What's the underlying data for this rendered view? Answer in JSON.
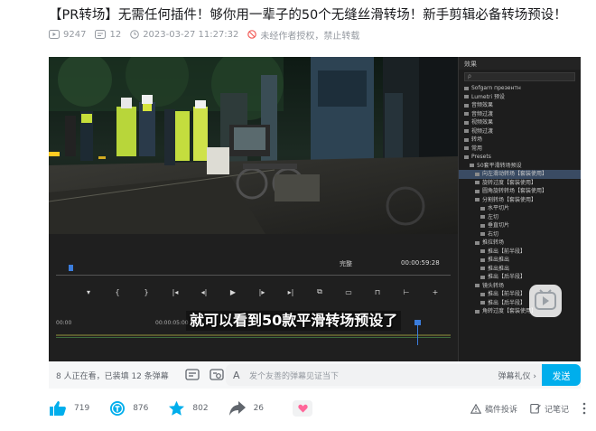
{
  "video": {
    "title": "【PR转场】无需任何插件！够你用一辈子的50个无缝丝滑转场！新手剪辑必备转场预设！",
    "plays": "9247",
    "danmaku_count": "12",
    "published": "2023-03-27 11:27:32",
    "copyright_note": "未经作者授权，禁止转载"
  },
  "player": {
    "subtitle": "就可以看到50款平滑转场预设了",
    "fit_label": "完整",
    "timecode": "00:00:59:28",
    "ruler_left": "00:00",
    "ruler_mid": "00:00:05:00",
    "panel": {
      "header": "效果",
      "search_placeholder": "ρ",
      "items": [
        "Sofgarn презентн",
        "Lumetri 预设",
        "音频效果",
        "音频过渡",
        "视频效果",
        "视频过渡",
        "转场",
        "常用",
        "Presets",
        "50套平滑转场预设",
        "向左滑动转场【套装使用】",
        "旋转过度【套装使用】",
        "圆角旋转转场【套装使用】",
        "分割转场【套装使用】",
        "水平切片",
        "左切",
        "垂直切片",
        "右切",
        "推拉转场",
        "推出【前半段】",
        "推出推出",
        "推出推出",
        "推出【后半段】",
        "镜头转场",
        "推出【前半段】",
        "推出【后半段】",
        "角转过度【套装使用】"
      ],
      "selected_index": 10
    }
  },
  "danmu_bar": {
    "viewers": "8 人正在看，已装填 12 条弹幕",
    "input_icon": "A",
    "placeholder": "发个友善的弹幕见证当下",
    "etiquette": "弹幕礼仪 ›",
    "send": "发送"
  },
  "actions": {
    "like": "719",
    "coin": "876",
    "fav": "802",
    "share": "26",
    "report": "稿件投诉",
    "notes": "记笔记"
  },
  "colors": {
    "accent": "#00aeec",
    "icon_blue": "#00aeec",
    "muted": "#9499a0",
    "heart": "#ff6699"
  }
}
